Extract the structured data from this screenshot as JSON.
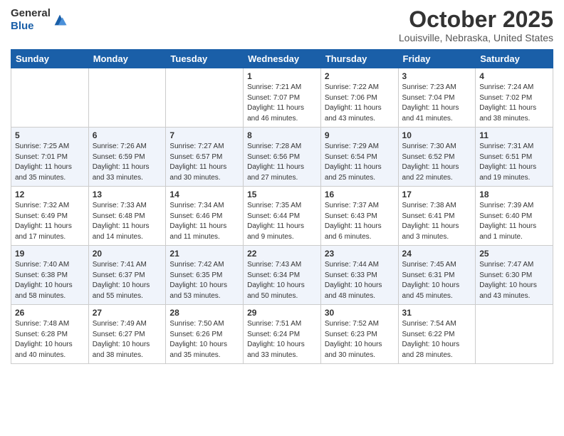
{
  "header": {
    "logo_general": "General",
    "logo_blue": "Blue",
    "month": "October 2025",
    "location": "Louisville, Nebraska, United States"
  },
  "days_of_week": [
    "Sunday",
    "Monday",
    "Tuesday",
    "Wednesday",
    "Thursday",
    "Friday",
    "Saturday"
  ],
  "weeks": [
    [
      {
        "day": "",
        "info": ""
      },
      {
        "day": "",
        "info": ""
      },
      {
        "day": "",
        "info": ""
      },
      {
        "day": "1",
        "info": "Sunrise: 7:21 AM\nSunset: 7:07 PM\nDaylight: 11 hours\nand 46 minutes."
      },
      {
        "day": "2",
        "info": "Sunrise: 7:22 AM\nSunset: 7:06 PM\nDaylight: 11 hours\nand 43 minutes."
      },
      {
        "day": "3",
        "info": "Sunrise: 7:23 AM\nSunset: 7:04 PM\nDaylight: 11 hours\nand 41 minutes."
      },
      {
        "day": "4",
        "info": "Sunrise: 7:24 AM\nSunset: 7:02 PM\nDaylight: 11 hours\nand 38 minutes."
      }
    ],
    [
      {
        "day": "5",
        "info": "Sunrise: 7:25 AM\nSunset: 7:01 PM\nDaylight: 11 hours\nand 35 minutes."
      },
      {
        "day": "6",
        "info": "Sunrise: 7:26 AM\nSunset: 6:59 PM\nDaylight: 11 hours\nand 33 minutes."
      },
      {
        "day": "7",
        "info": "Sunrise: 7:27 AM\nSunset: 6:57 PM\nDaylight: 11 hours\nand 30 minutes."
      },
      {
        "day": "8",
        "info": "Sunrise: 7:28 AM\nSunset: 6:56 PM\nDaylight: 11 hours\nand 27 minutes."
      },
      {
        "day": "9",
        "info": "Sunrise: 7:29 AM\nSunset: 6:54 PM\nDaylight: 11 hours\nand 25 minutes."
      },
      {
        "day": "10",
        "info": "Sunrise: 7:30 AM\nSunset: 6:52 PM\nDaylight: 11 hours\nand 22 minutes."
      },
      {
        "day": "11",
        "info": "Sunrise: 7:31 AM\nSunset: 6:51 PM\nDaylight: 11 hours\nand 19 minutes."
      }
    ],
    [
      {
        "day": "12",
        "info": "Sunrise: 7:32 AM\nSunset: 6:49 PM\nDaylight: 11 hours\nand 17 minutes."
      },
      {
        "day": "13",
        "info": "Sunrise: 7:33 AM\nSunset: 6:48 PM\nDaylight: 11 hours\nand 14 minutes."
      },
      {
        "day": "14",
        "info": "Sunrise: 7:34 AM\nSunset: 6:46 PM\nDaylight: 11 hours\nand 11 minutes."
      },
      {
        "day": "15",
        "info": "Sunrise: 7:35 AM\nSunset: 6:44 PM\nDaylight: 11 hours\nand 9 minutes."
      },
      {
        "day": "16",
        "info": "Sunrise: 7:37 AM\nSunset: 6:43 PM\nDaylight: 11 hours\nand 6 minutes."
      },
      {
        "day": "17",
        "info": "Sunrise: 7:38 AM\nSunset: 6:41 PM\nDaylight: 11 hours\nand 3 minutes."
      },
      {
        "day": "18",
        "info": "Sunrise: 7:39 AM\nSunset: 6:40 PM\nDaylight: 11 hours\nand 1 minute."
      }
    ],
    [
      {
        "day": "19",
        "info": "Sunrise: 7:40 AM\nSunset: 6:38 PM\nDaylight: 10 hours\nand 58 minutes."
      },
      {
        "day": "20",
        "info": "Sunrise: 7:41 AM\nSunset: 6:37 PM\nDaylight: 10 hours\nand 55 minutes."
      },
      {
        "day": "21",
        "info": "Sunrise: 7:42 AM\nSunset: 6:35 PM\nDaylight: 10 hours\nand 53 minutes."
      },
      {
        "day": "22",
        "info": "Sunrise: 7:43 AM\nSunset: 6:34 PM\nDaylight: 10 hours\nand 50 minutes."
      },
      {
        "day": "23",
        "info": "Sunrise: 7:44 AM\nSunset: 6:33 PM\nDaylight: 10 hours\nand 48 minutes."
      },
      {
        "day": "24",
        "info": "Sunrise: 7:45 AM\nSunset: 6:31 PM\nDaylight: 10 hours\nand 45 minutes."
      },
      {
        "day": "25",
        "info": "Sunrise: 7:47 AM\nSunset: 6:30 PM\nDaylight: 10 hours\nand 43 minutes."
      }
    ],
    [
      {
        "day": "26",
        "info": "Sunrise: 7:48 AM\nSunset: 6:28 PM\nDaylight: 10 hours\nand 40 minutes."
      },
      {
        "day": "27",
        "info": "Sunrise: 7:49 AM\nSunset: 6:27 PM\nDaylight: 10 hours\nand 38 minutes."
      },
      {
        "day": "28",
        "info": "Sunrise: 7:50 AM\nSunset: 6:26 PM\nDaylight: 10 hours\nand 35 minutes."
      },
      {
        "day": "29",
        "info": "Sunrise: 7:51 AM\nSunset: 6:24 PM\nDaylight: 10 hours\nand 33 minutes."
      },
      {
        "day": "30",
        "info": "Sunrise: 7:52 AM\nSunset: 6:23 PM\nDaylight: 10 hours\nand 30 minutes."
      },
      {
        "day": "31",
        "info": "Sunrise: 7:54 AM\nSunset: 6:22 PM\nDaylight: 10 hours\nand 28 minutes."
      },
      {
        "day": "",
        "info": ""
      }
    ]
  ]
}
